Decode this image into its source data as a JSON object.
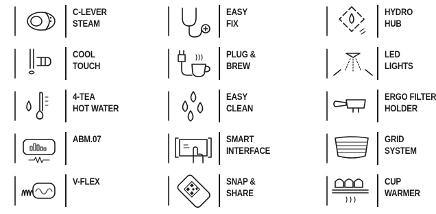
{
  "features": [
    {
      "icon": "steam-lever-icon",
      "line1": "C-LEVER",
      "line2": "STEAM"
    },
    {
      "icon": "stethoscope-icon",
      "line1": "EASY",
      "line2": "FIX"
    },
    {
      "icon": "hydro-hub-icon",
      "line1": "HYDRO",
      "line2": "HUB"
    },
    {
      "icon": "cool-touch-icon",
      "line1": "COOL",
      "line2": "TOUCH"
    },
    {
      "icon": "plug-cup-icon",
      "line1": "PLUG &",
      "line2": "BREW"
    },
    {
      "icon": "led-lamp-icon",
      "line1": "LED",
      "line2": "LIGHTS"
    },
    {
      "icon": "drop-thermometer-icon",
      "line1": "4-TEA",
      "line2": "HOT WATER"
    },
    {
      "icon": "water-drops-icon",
      "line1": "EASY",
      "line2": "CLEAN"
    },
    {
      "icon": "portafilter-icon",
      "line1": "ERGO FILTER",
      "line2": "HOLDER"
    },
    {
      "icon": "abm-display-icon",
      "line1": "ABM.07",
      "line2": ""
    },
    {
      "icon": "touch-screen-icon",
      "line1": "SMART",
      "line2": "INTERFACE"
    },
    {
      "icon": "filter-grid-icon",
      "line1": "GRID",
      "line2": "SYSTEM"
    },
    {
      "icon": "pressure-wave-icon",
      "line1": "V-FLEX",
      "line2": ""
    },
    {
      "icon": "smartphone-qr-icon",
      "line1": "SNAP &",
      "line2": "SHARE"
    },
    {
      "icon": "cup-warmer-icon",
      "line1": "CUP",
      "line2": "WARMER"
    }
  ]
}
